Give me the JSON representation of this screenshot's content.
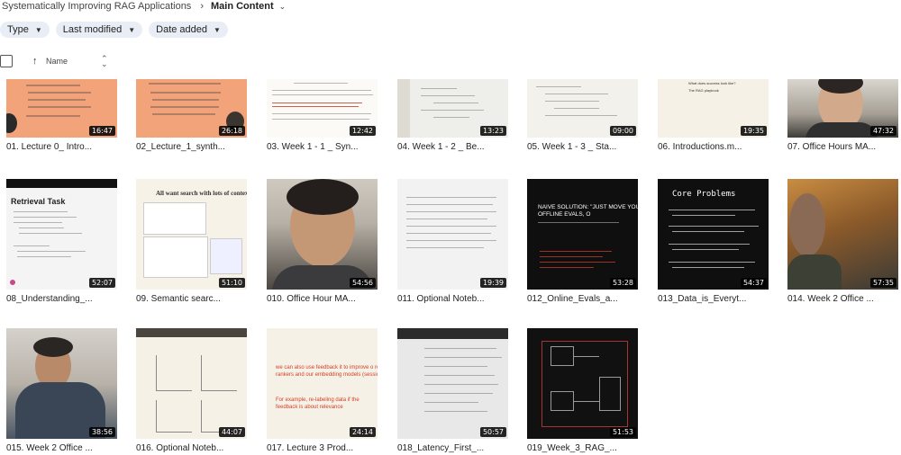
{
  "breadcrumb": {
    "root": "Systematically Improving RAG Applications",
    "separator": "›",
    "current": "Main Content",
    "caret": "⌄"
  },
  "filters": [
    {
      "label": "Type"
    },
    {
      "label": "Last modified"
    },
    {
      "label": "Date added"
    }
  ],
  "list_header": {
    "name_label": "Name",
    "sort_arrow": "↑",
    "toggle": "⌃⌄"
  },
  "thumbnail_text": {
    "retrieval_task": "Retrieval Task",
    "semantic_search": "All want search with lots of contex",
    "naive_solution": "NAIVE SOLUTION: \"JUST MOVE YOUR OFFLINE EVALS, O",
    "core_problems": "Core Problems",
    "feedback": "we can also use feedback it to improve o re-rankers and our embedding models (session 2).",
    "feedback_example": "For example, re-labeling data if the feedback is about relevance",
    "intro_q": "What does success look like?",
    "office_caption": "The RAG playbook"
  },
  "files": [
    {
      "title": "01. Lecture 0_ Intro...",
      "duration": "16:47"
    },
    {
      "title": "02_Lecture_1_synth...",
      "duration": "26:18"
    },
    {
      "title": "03. Week 1 - 1 _ Syn...",
      "duration": "12:42"
    },
    {
      "title": "04. Week 1 - 2 _ Be...",
      "duration": "13:23"
    },
    {
      "title": "05. Week 1 - 3 _ Sta...",
      "duration": "09:00"
    },
    {
      "title": "06. Introductions.m...",
      "duration": "19:35"
    },
    {
      "title": "07. Office Hours MA...",
      "duration": "47:32"
    },
    {
      "title": "08_Understanding_...",
      "duration": "52:07"
    },
    {
      "title": "09. Semantic searc...",
      "duration": "51:10"
    },
    {
      "title": "010. Office Hour MA...",
      "duration": "54:56"
    },
    {
      "title": "011. Optional Noteb...",
      "duration": "19:39"
    },
    {
      "title": "012_Online_Evals_a...",
      "duration": "53:28"
    },
    {
      "title": "013_Data_is_Everyt...",
      "duration": "54:37"
    },
    {
      "title": "014. Week 2 Office ...",
      "duration": "57:35"
    },
    {
      "title": "015. Week 2 Office ...",
      "duration": "38:56"
    },
    {
      "title": "016. Optional Noteb...",
      "duration": "44:07"
    },
    {
      "title": "017. Lecture 3 Prod...",
      "duration": "24:14"
    },
    {
      "title": "018_Latency_First_...",
      "duration": "50:57"
    },
    {
      "title": "019_Week_3_RAG_...",
      "duration": "51:53"
    }
  ],
  "icons": {
    "sort": "arrow-up-icon",
    "chevron": "chevron-down-icon"
  }
}
